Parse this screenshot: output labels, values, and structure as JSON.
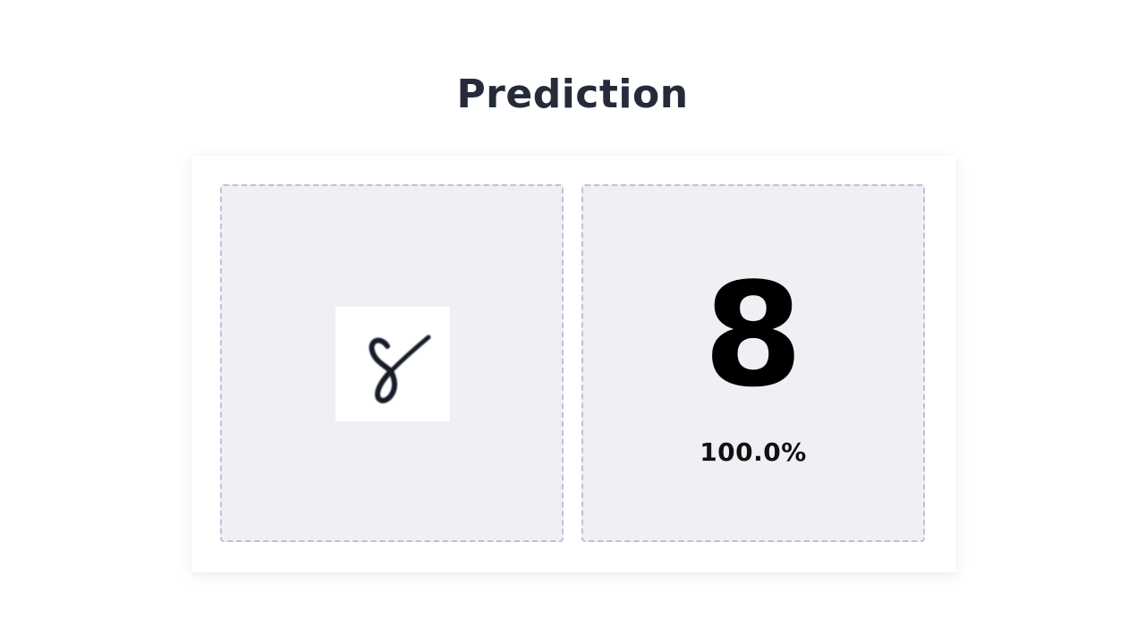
{
  "header": {
    "title": "Prediction"
  },
  "input": {
    "image_description": "handwritten-digit-icon"
  },
  "result": {
    "digit": "8",
    "confidence": "100.0%"
  },
  "colors": {
    "title": "#262b3a",
    "panel_bg": "#f0eff4",
    "panel_border": "#c2bfd4",
    "digit": "#000000"
  }
}
